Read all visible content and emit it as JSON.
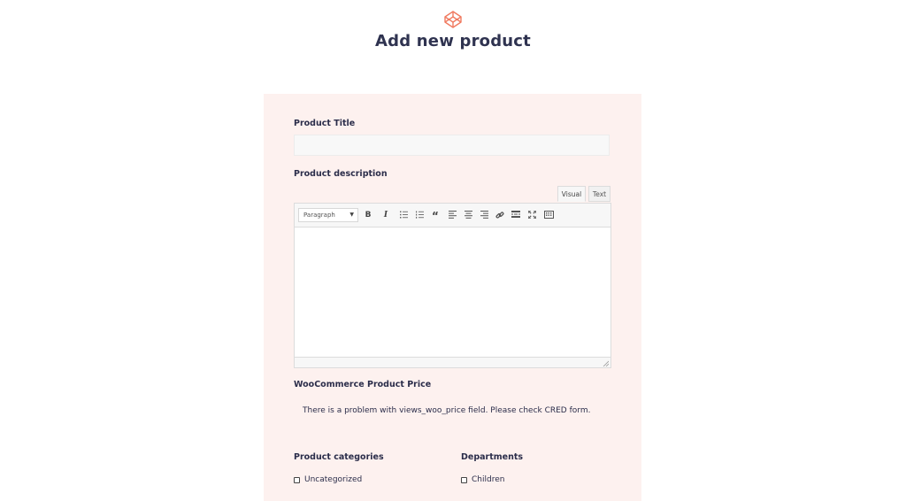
{
  "header": {
    "title": "Add new product",
    "logo_icon": "codepen-logo-icon",
    "logo_color": "#f07a60"
  },
  "form": {
    "product_title_label": "Product Title",
    "product_title_value": "",
    "product_description_label": "Product description",
    "editor": {
      "tabs": [
        {
          "label": "Visual",
          "active": true
        },
        {
          "label": "Text",
          "active": false
        }
      ],
      "format_select": "Paragraph",
      "toolbar_buttons": [
        {
          "name": "bold",
          "glyph": "B"
        },
        {
          "name": "italic",
          "glyph": "I"
        },
        {
          "name": "bulleted-list",
          "glyph": ""
        },
        {
          "name": "numbered-list",
          "glyph": ""
        },
        {
          "name": "blockquote",
          "glyph": "“"
        },
        {
          "name": "align-left",
          "glyph": ""
        },
        {
          "name": "align-center",
          "glyph": ""
        },
        {
          "name": "align-right",
          "glyph": ""
        },
        {
          "name": "link",
          "glyph": ""
        },
        {
          "name": "read-more",
          "glyph": ""
        },
        {
          "name": "fullscreen",
          "glyph": ""
        },
        {
          "name": "toolbar-toggle",
          "glyph": ""
        }
      ],
      "content": ""
    },
    "price_label": "WooCommerce Product Price",
    "price_message": "There is a problem with views_woo_price field. Please check CRED form.",
    "categories_label": "Product categories",
    "categories": [
      {
        "label": "Uncategorized",
        "checked": false
      }
    ],
    "departments_label": "Departments",
    "departments": [
      {
        "label": "Children",
        "checked": false
      }
    ]
  },
  "colors": {
    "panel_bg": "#fdf1ef",
    "text": "#2b2d4a"
  }
}
